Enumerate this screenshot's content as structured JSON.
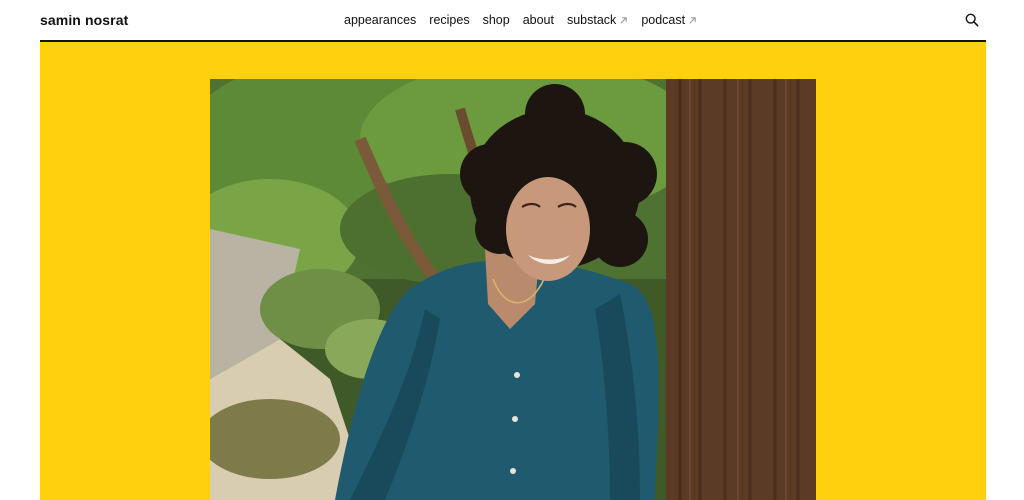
{
  "header": {
    "logo": "samin nosrat",
    "nav": [
      {
        "label": "appearances",
        "external": false
      },
      {
        "label": "recipes",
        "external": false
      },
      {
        "label": "shop",
        "external": false
      },
      {
        "label": "about",
        "external": false
      },
      {
        "label": "substack",
        "external": true
      },
      {
        "label": "podcast",
        "external": true
      }
    ],
    "search_icon": "search-icon",
    "external_icon": "arrow-up-right-icon"
  },
  "hero": {
    "background_color": "#ffd00e",
    "photo": "portrait-photo"
  }
}
